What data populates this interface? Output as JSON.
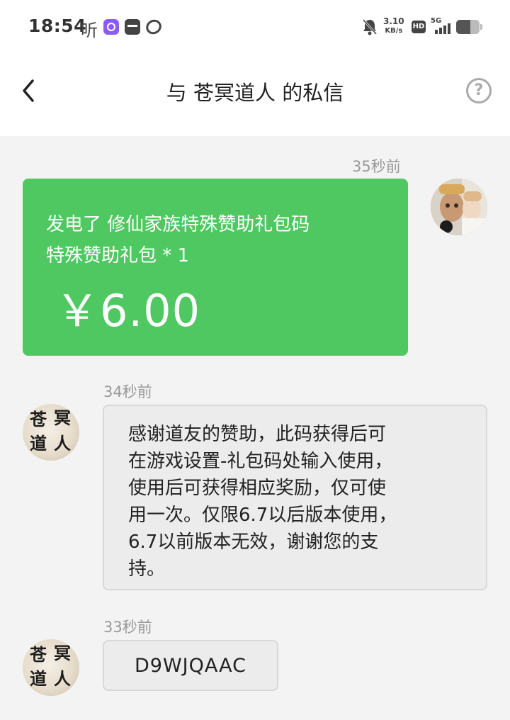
{
  "status_bar": {
    "time": "18:54",
    "ting_label": "听",
    "net_speed_value": "3.10",
    "net_speed_unit": "KB/s",
    "hd_label": "HD",
    "network_type": "5G",
    "battery_level_percent": 60,
    "icons": [
      "app-purple-icon",
      "app-box-icon",
      "app-ring-icon",
      "mute-icon",
      "signal-icon",
      "battery-icon"
    ]
  },
  "header": {
    "title": "与 苍冥道人 的私信",
    "back_icon": "chevron-left-icon",
    "help_label": "?"
  },
  "colors": {
    "gift_card": "#4fc862",
    "bubble_bg": "#ececec",
    "page_bg": "#f3f3f3"
  },
  "messages": [
    {
      "side": "right",
      "time": "35秒前",
      "type": "gift",
      "line1": "发电了 修仙家族特殊赞助礼包码",
      "line2": "特殊赞助礼包 * 1",
      "amount": "￥6.00"
    },
    {
      "side": "left",
      "time": "34秒前",
      "type": "text",
      "avatar_chars": [
        "苍",
        "冥",
        "道",
        "人"
      ],
      "text": "感谢道友的赞助，此码获得后可\n在游戏设置-礼包码处输入使用，\n使用后可获得相应奖励，仅可使\n用一次。仅限6.7以后版本使用，\n6.7以前版本无效，谢谢您的支\n持。"
    },
    {
      "side": "left",
      "time": "33秒前",
      "type": "text",
      "avatar_chars": [
        "苍",
        "冥",
        "道",
        "人"
      ],
      "text": "D9WJQAAC"
    }
  ]
}
